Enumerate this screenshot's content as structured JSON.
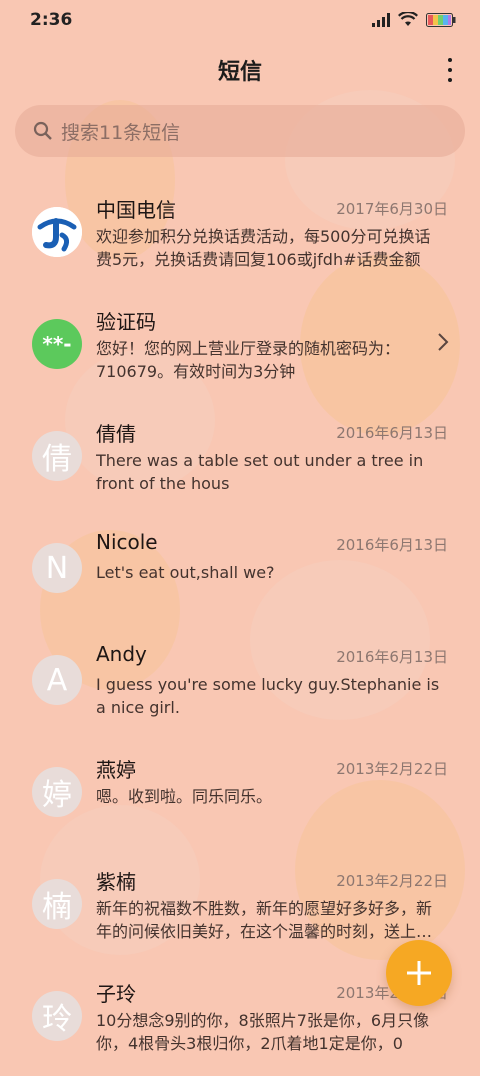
{
  "status_bar": {
    "time": "2:36"
  },
  "header": {
    "title": "短信"
  },
  "search": {
    "placeholder": "搜索11条短信"
  },
  "conversations": [
    {
      "avatar_text": "",
      "name": "中国电信",
      "date": "2017年6月30日",
      "preview": "欢迎参加积分兑换话费活动，每500分可兑换话费5元，兑换话费请回复106或jfdh#话费金额"
    },
    {
      "avatar_text": "**-",
      "name": "验证码",
      "date": "",
      "preview": "您好！您的网上营业厅登录的随机密码为：710679。有效时间为3分钟"
    },
    {
      "avatar_text": "倩",
      "name": "倩倩",
      "date": "2016年6月13日",
      "preview": "There was a table set out under a tree in front of the hous"
    },
    {
      "avatar_text": "N",
      "name": "Nicole",
      "date": "2016年6月13日",
      "preview": "Let's eat out,shall we?"
    },
    {
      "avatar_text": "A",
      "name": "Andy",
      "date": "2016年6月13日",
      "preview": "I guess you're some lucky guy.Stephanie is a nice girl."
    },
    {
      "avatar_text": "婷",
      "name": "燕婷",
      "date": "2013年2月22日",
      "preview": "嗯。收到啦。同乐同乐。"
    },
    {
      "avatar_text": "楠",
      "name": "紫楠",
      "date": "2013年2月22日",
      "preview": "新年的祝福数不胜数，新年的愿望好多好多，新年的问候依旧美好，在这个温馨的时刻，送上我的祝福"
    },
    {
      "avatar_text": "玲",
      "name": "子玲",
      "date": "2013年2月22日",
      "preview": "10分想念9别的你，8张照片7张是你，6月只像你，4根骨头3根归你，2爪着地1定是你，0"
    }
  ],
  "colors": {
    "background": "#f9c7b3",
    "fab": "#f6a823",
    "telecom_blue": "#1a5fb4",
    "verify_green": "#5cc95c"
  }
}
